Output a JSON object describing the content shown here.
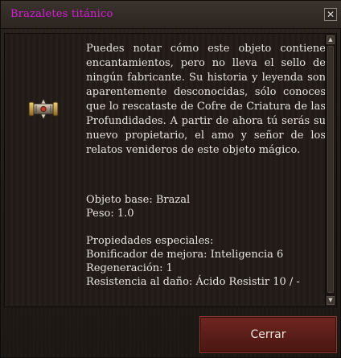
{
  "window": {
    "title": "Brazaletes titánico",
    "title_color": "#d61fd6",
    "close_label": "✕"
  },
  "item": {
    "icon": "bracers-icon",
    "description": "Puedes notar cómo este objeto contiene encantamientos, pero no lleva el sello de ningún fabricante. Su historia y leyenda son aparentemente desconocidas, sólo conoces que lo rescataste de Cofre de Criatura de las Profundidades. A partir de ahora tú serás su nuevo propietario, el amo y señor de los relatos venideros de este objeto mágico.",
    "base_object": "Objeto base: Brazal",
    "weight": "Peso: 1.0",
    "special_properties_header": "Propiedades especiales:",
    "properties": [
      "Bonificador de mejora: Inteligencia 6",
      "Regeneración: 1",
      "Resistencia al daño: Ácido Resistir 10 / -"
    ]
  },
  "scrollbar": {
    "up_arrow": "▲",
    "down_arrow": "▼"
  },
  "footer": {
    "close_button_label": "Cerrar",
    "button_color": "#5a1d18"
  }
}
